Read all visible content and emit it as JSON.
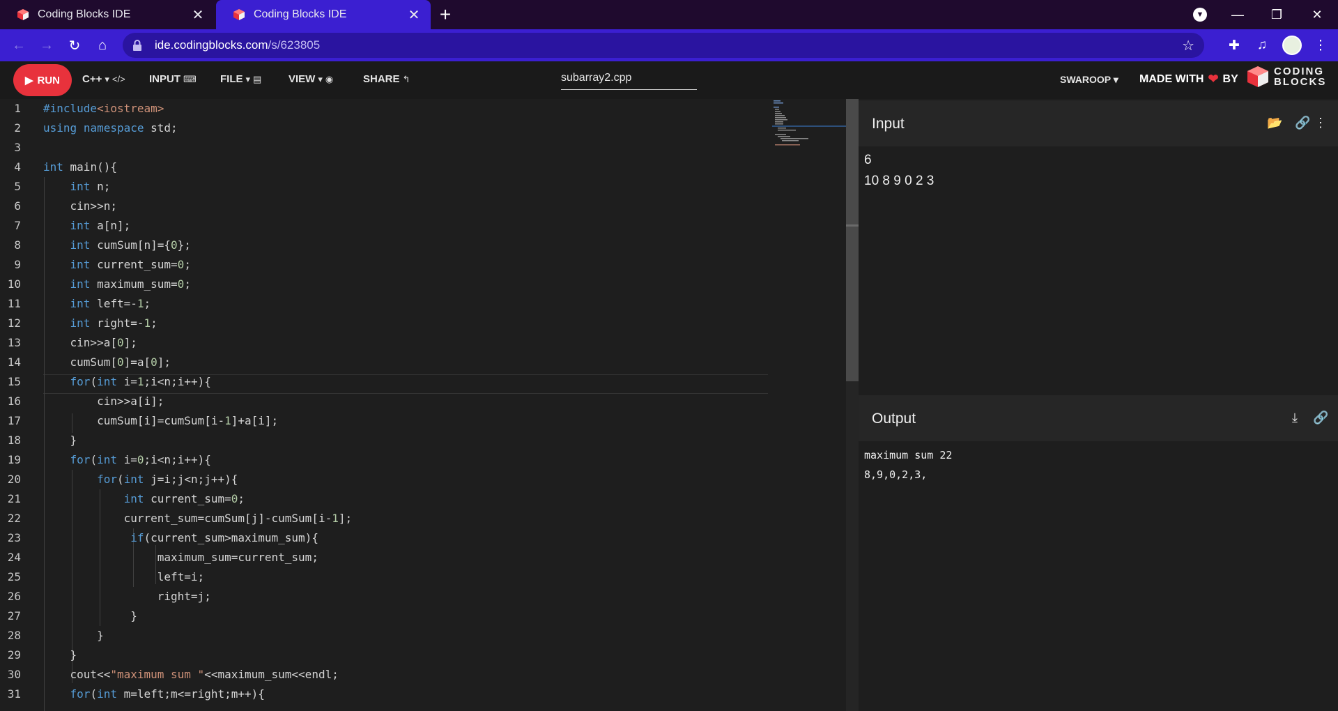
{
  "browser": {
    "tabs": [
      {
        "title": "Coding Blocks IDE",
        "active": false
      },
      {
        "title": "Coding Blocks IDE",
        "active": true
      }
    ],
    "url_host": "ide.codingblocks.com",
    "url_path": "/s/623805"
  },
  "ide": {
    "run_label": "RUN",
    "menu": {
      "language": "C++",
      "input": "INPUT",
      "file": "FILE",
      "view": "VIEW",
      "share": "SHARE"
    },
    "filename": "subarray2.cpp",
    "user": "SWAROOP",
    "made_with": "MADE WITH",
    "by": "BY",
    "brand_line1": "CODING",
    "brand_line2": "BLOCKS"
  },
  "editor": {
    "line_numbers": [
      "1",
      "2",
      "3",
      "4",
      "5",
      "6",
      "7",
      "8",
      "9",
      "10",
      "11",
      "12",
      "13",
      "14",
      "15",
      "16",
      "17",
      "18",
      "19",
      "20",
      "21",
      "22",
      "23",
      "24",
      "25",
      "26",
      "27",
      "28",
      "29",
      "30",
      "31"
    ],
    "current_line": 15
  },
  "input_panel": {
    "title": "Input",
    "lines": [
      "6",
      "10 8 9 0 2 3"
    ]
  },
  "output_panel": {
    "title": "Output",
    "lines": [
      "maximum sum 22",
      "8,9,0,2,3,"
    ]
  },
  "colors": {
    "accent_run": "#e8323c",
    "browser_chrome": "#3b1fd1",
    "keyword": "#569cd6",
    "number": "#b5cea8",
    "string": "#ce9178"
  }
}
